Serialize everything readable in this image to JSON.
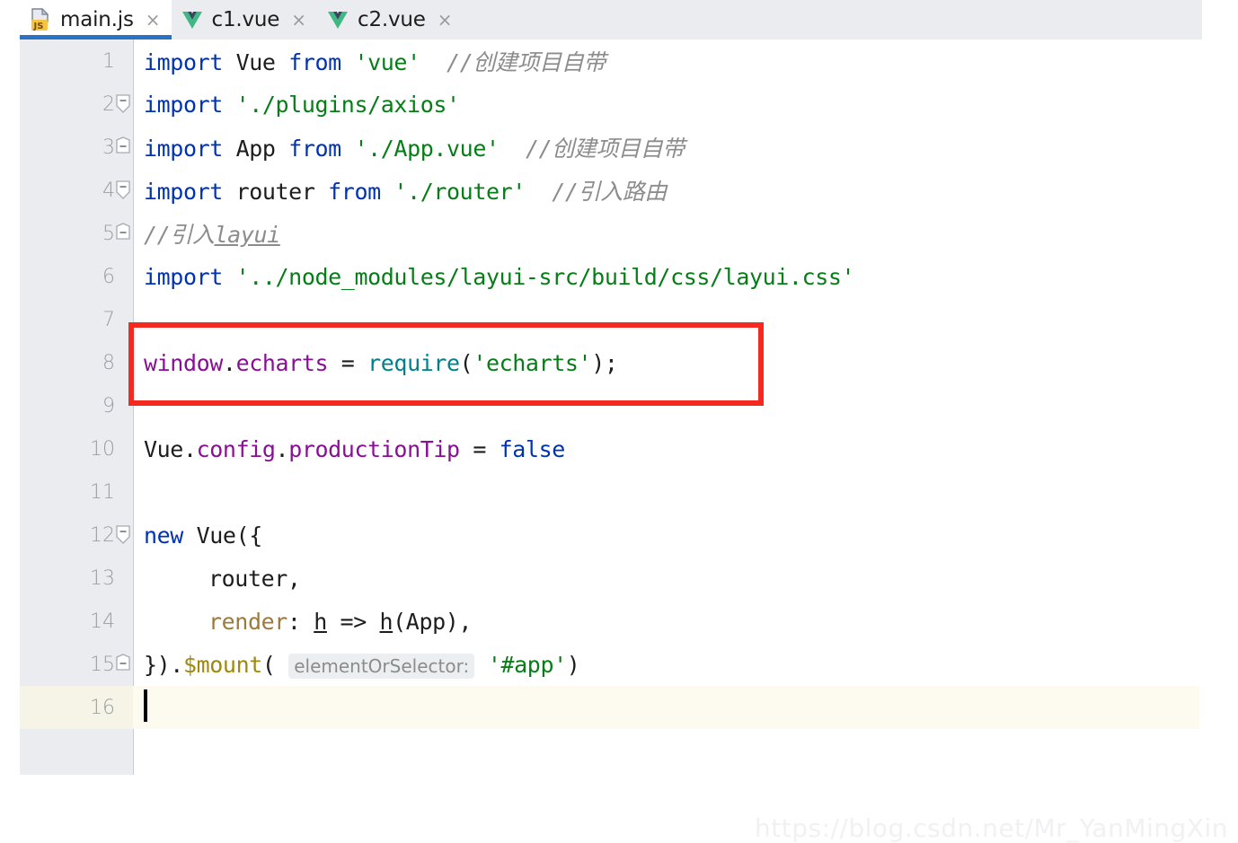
{
  "window": {
    "app": "IntelliJ IDEA Editor",
    "file": "main.js"
  },
  "tabs": [
    {
      "label": "main.js",
      "icon": "js-file-icon",
      "active": true,
      "close": "×"
    },
    {
      "label": "c1.vue",
      "icon": "vue-file-icon",
      "active": false,
      "close": "×"
    },
    {
      "label": "c2.vue",
      "icon": "vue-file-icon",
      "active": false,
      "close": "×"
    }
  ],
  "editor": {
    "line_numbers": [
      "1",
      "2",
      "3",
      "4",
      "5",
      "6",
      "7",
      "8",
      "9",
      "10",
      "11",
      "12",
      "13",
      "14",
      "15",
      "16"
    ],
    "caret_line": 16,
    "inlay_hint": "elementOrSelector:",
    "lines": [
      {
        "n": "1",
        "fold": false,
        "text": "import Vue from 'vue'  //创建项目自带"
      },
      {
        "n": "2",
        "fold": true,
        "text": "import './plugins/axios'"
      },
      {
        "n": "3",
        "fold": true,
        "text": "import App from './App.vue'  //创建项目自带"
      },
      {
        "n": "4",
        "fold": true,
        "text": "import router from './router'  //引入路由"
      },
      {
        "n": "5",
        "fold": true,
        "text": "//引入layui"
      },
      {
        "n": "6",
        "fold": false,
        "text": "import '../node_modules/layui-src/build/css/layui.css'"
      },
      {
        "n": "7",
        "fold": false,
        "text": ""
      },
      {
        "n": "8",
        "fold": false,
        "text": "window.echarts = require('echarts');"
      },
      {
        "n": "9",
        "fold": false,
        "text": ""
      },
      {
        "n": "10",
        "fold": false,
        "text": "Vue.config.productionTip = false"
      },
      {
        "n": "11",
        "fold": false,
        "text": ""
      },
      {
        "n": "12",
        "fold": true,
        "text": "new Vue({"
      },
      {
        "n": "13",
        "fold": false,
        "text": "    router,"
      },
      {
        "n": "14",
        "fold": false,
        "text": "    render: h => h(App),"
      },
      {
        "n": "15",
        "fold": true,
        "text": "}).$mount( elementOrSelector: '#app')"
      },
      {
        "n": "16",
        "fold": false,
        "text": ""
      }
    ],
    "tokens": {
      "line1": {
        "kw1": "import",
        "name": "Vue",
        "kw2": "from",
        "str": "'vue'",
        "comment": "//创建项目自带"
      },
      "line2": {
        "kw1": "import",
        "str": "'./plugins/axios'"
      },
      "line3": {
        "kw1": "import",
        "name": "App",
        "kw2": "from",
        "str": "'./App.vue'",
        "comment": "//创建项目自带"
      },
      "line4": {
        "kw1": "import",
        "name": "router",
        "kw2": "from",
        "str": "'./router'",
        "comment": "//引入路由"
      },
      "line5": {
        "comment": "//引入",
        "comment_underlined": "layui"
      },
      "line6": {
        "kw1": "import",
        "str": "'../node_modules/layui-src/build/css/layui.css'"
      },
      "line8": {
        "obj": "window",
        "dot1": ".",
        "prop": "echarts",
        "eq": " = ",
        "fn": "require",
        "open": "(",
        "str": "'echarts'",
        "close": ");"
      },
      "line10": {
        "obj": "Vue",
        "dot1": ".",
        "p1": "config",
        "dot2": ".",
        "p2": "productionTip",
        "eq": " = ",
        "kw": "false"
      },
      "line12": {
        "kw": "new",
        "name": "Vue({"
      },
      "line13": {
        "text": "router,"
      },
      "line14": {
        "label": "render",
        "colon": ": ",
        "p1": "h",
        "arrow": " => ",
        "p2": "h",
        "rest": "(App),"
      },
      "line15": {
        "pre": "}).",
        "fn": "$mount",
        "open": "( ",
        "hint": "elementOrSelector:",
        "str": "'#app'",
        "close": ")"
      }
    }
  },
  "annotation": {
    "red_box_target_line": "8",
    "red_box_color": "#f42a21"
  },
  "watermark": {
    "text": "https://blog.csdn.net/Mr_YanMingXin"
  },
  "colors": {
    "keyword": "#0033b3",
    "string": "#067d17",
    "comment": "#8c8c8c",
    "field": "#871094",
    "function": "#00808a",
    "gold": "#9c7a3c",
    "tab_active_underline": "#2a73c4",
    "tabbar_bg": "#ebecf0",
    "caret_line_bg": "#fdfbf0"
  }
}
